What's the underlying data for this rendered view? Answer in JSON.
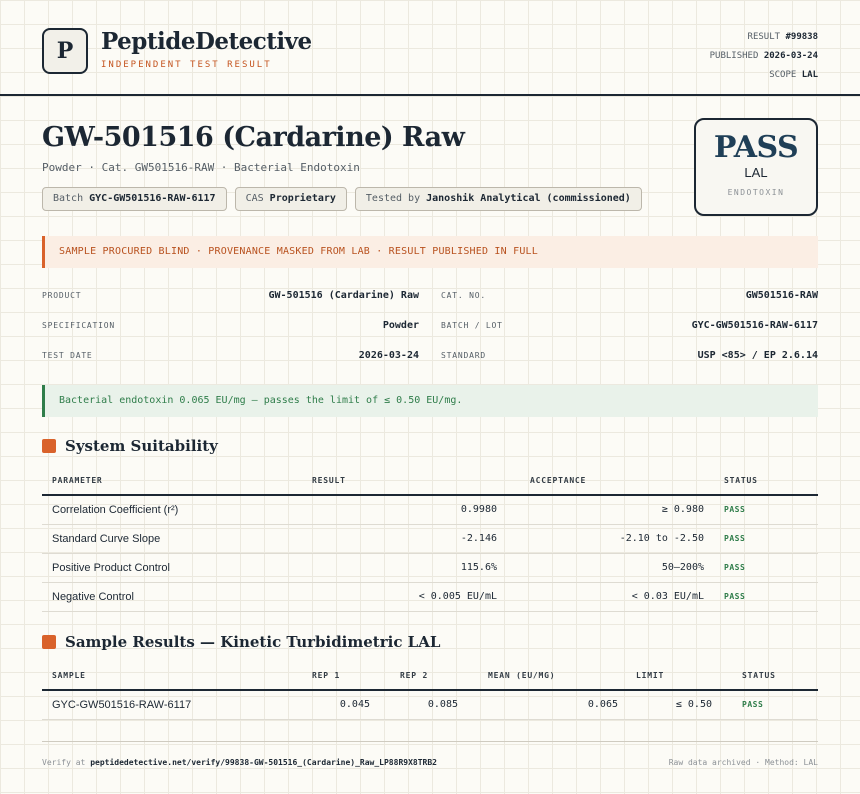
{
  "brand": {
    "logo_letter": "P",
    "name": "PeptideDetective",
    "tagline": "INDEPENDENT TEST RESULT"
  },
  "meta": {
    "result_label": "RESULT",
    "result_value": "#99838",
    "published_label": "PUBLISHED",
    "published_value": "2026-03-24",
    "scope_label": "SCOPE",
    "scope_value": "LAL"
  },
  "product": {
    "title": "GW-501516 (Cardarine) Raw",
    "subtitle": "Powder · Cat. GW501516-RAW · Bacterial Endotoxin",
    "chips": [
      {
        "label": "Batch",
        "value": "GYC-GW501516-RAW-6117"
      },
      {
        "label": "CAS",
        "value": "Proprietary"
      },
      {
        "label": "Tested by",
        "value": "Janoshik Analytical (commissioned)"
      }
    ]
  },
  "verdict": {
    "word": "PASS",
    "scope": "LAL",
    "kind": "ENDOTOXIN"
  },
  "banner": "SAMPLE PROCURED BLIND · PROVENANCE MASKED FROM LAB · RESULT PUBLISHED IN FULL",
  "info": [
    {
      "label": "PRODUCT",
      "value": "GW-501516 (Cardarine) Raw"
    },
    {
      "label": "CAT. NO.",
      "value": "GW501516-RAW"
    },
    {
      "label": "SPECIFICATION",
      "value": "Powder"
    },
    {
      "label": "BATCH / LOT",
      "value": "GYC-GW501516-RAW-6117"
    },
    {
      "label": "TEST DATE",
      "value": "2026-03-24"
    },
    {
      "label": "STANDARD",
      "value": "USP <85> / EP 2.6.14"
    }
  ],
  "note": "Bacterial endotoxin 0.065 EU/mg — passes the limit of ≤ 0.50 EU/mg.",
  "suitability": {
    "title": "System Suitability",
    "headers": [
      "PARAMETER",
      "RESULT",
      "ACCEPTANCE",
      "STATUS"
    ],
    "rows": [
      {
        "parameter": "Correlation Coefficient (r²)",
        "result": "0.9980",
        "acceptance": "≥ 0.980",
        "status": "PASS"
      },
      {
        "parameter": "Standard Curve Slope",
        "result": "-2.146",
        "acceptance": "-2.10 to -2.50",
        "status": "PASS"
      },
      {
        "parameter": "Positive Product Control",
        "result": "115.6%",
        "acceptance": "50–200%",
        "status": "PASS"
      },
      {
        "parameter": "Negative Control",
        "result": "< 0.005 EU/mL",
        "acceptance": "< 0.03 EU/mL",
        "status": "PASS"
      }
    ]
  },
  "samples": {
    "title": "Sample Results — Kinetic Turbidimetric LAL",
    "headers": [
      "SAMPLE",
      "REP 1",
      "REP 2",
      "MEAN (EU/MG)",
      "LIMIT",
      "STATUS"
    ],
    "rows": [
      {
        "sample": "GYC-GW501516-RAW-6117",
        "rep1": "0.045",
        "rep2": "0.085",
        "mean": "0.065",
        "limit": "≤ 0.50",
        "status": "PASS"
      }
    ]
  },
  "footer": {
    "verify_prefix": "Verify at",
    "verify_url": "peptidedetective.net/verify/99838-GW-501516_(Cardarine)_Raw_LP88R9X8TRB2",
    "right": "Raw data archived · Method: LAL"
  }
}
